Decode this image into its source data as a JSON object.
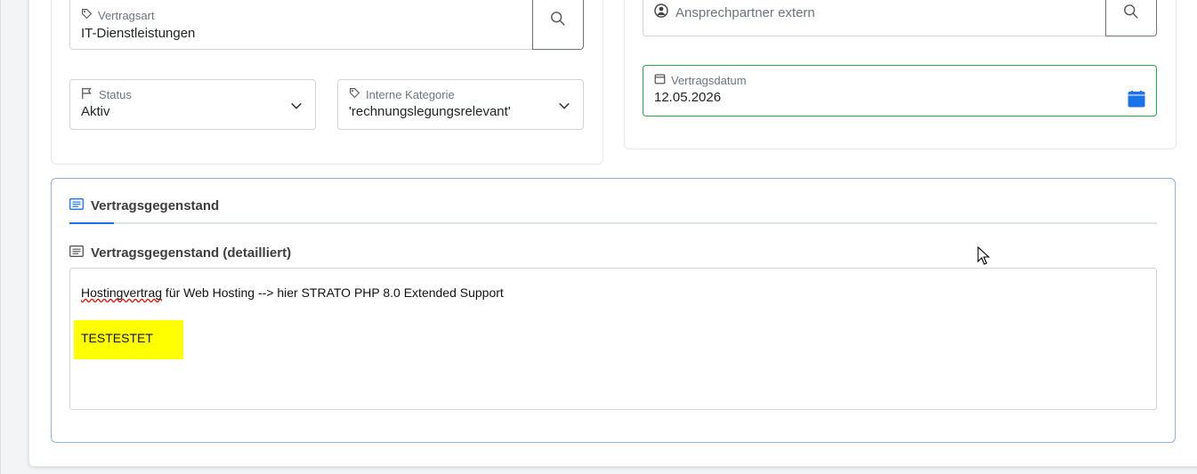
{
  "left_column": {
    "vertragsart": {
      "label": "Vertragsart",
      "value": "IT-Dienstleistungen",
      "search_icon": "search-icon",
      "tag_icon": "tag-icon"
    },
    "status": {
      "label": "Status",
      "value": "Aktiv",
      "icon": "flag-icon"
    },
    "interne_kategorie": {
      "label": "Interne Kategorie",
      "value": "'rechnungslegungsrelevant'",
      "icon": "tag-icon"
    }
  },
  "right_column": {
    "ansprechpartner": {
      "placeholder": "Ansprechpartner extern",
      "icon": "user-circle-icon",
      "search_icon": "search-icon"
    },
    "vertragsdatum": {
      "label": "Vertragsdatum",
      "value": "12.05.2026",
      "icon": "calendar-icon",
      "picker_icon": "calendar-picker-icon",
      "border_color": "#28a745"
    }
  },
  "vertragsgegenstand": {
    "tab_label": "Vertragsgegenstand",
    "section_title": "Vertragsgegenstand (detailliert)",
    "text_word_misspelled": "Hostingvertrag",
    "text_rest": " für Web Hosting --> hier STRATO PHP 8.0 Extended Support",
    "highlight_text": "TESTESTET",
    "highlight_color": "#ffff00",
    "accent_color": "#1a73e8"
  }
}
